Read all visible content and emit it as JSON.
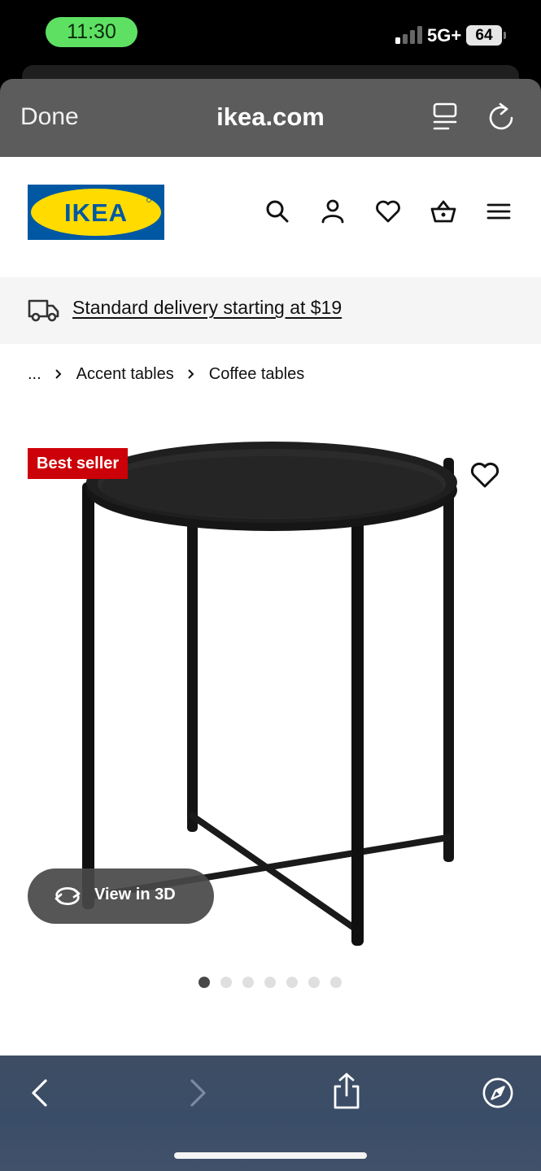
{
  "status_bar": {
    "time": "11:30",
    "network": "5G+",
    "battery": "64"
  },
  "browser": {
    "done_label": "Done",
    "url": "ikea.com"
  },
  "site": {
    "logo_text": "IKEA",
    "delivery_text": "Standard delivery starting at $19"
  },
  "breadcrumb": {
    "ellipsis": "...",
    "items": [
      "Accent tables",
      "Coffee tables"
    ]
  },
  "product": {
    "badge": "Best seller",
    "view3d_label": "View in 3D",
    "gallery": {
      "total": 7,
      "active": 1
    }
  },
  "colors": {
    "ikea_blue": "#0058a3",
    "ikea_yellow": "#ffdb00",
    "badge_red": "#cc0008",
    "status_green": "#5ee163"
  }
}
